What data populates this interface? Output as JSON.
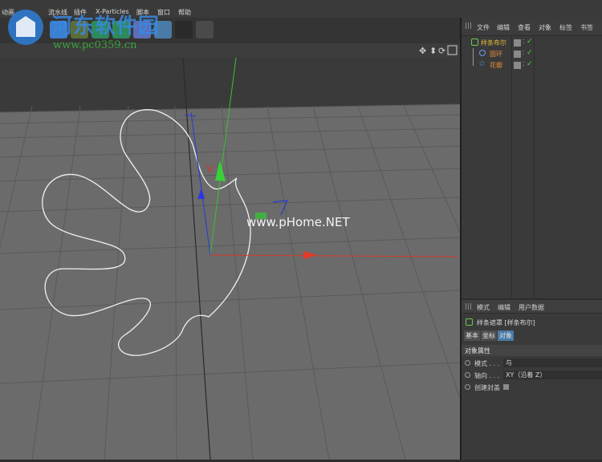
{
  "menubar": {
    "items": [
      "动画",
      "",
      "流水线",
      "插件",
      "X-Particles",
      "脚本",
      "窗口",
      "帮助"
    ]
  },
  "watermark": {
    "logo_text": "河东软件园",
    "url_text": "www.pc0359.cn",
    "center_text": "www.pHome.NET"
  },
  "object_manager": {
    "menu": [
      "文件",
      "编辑",
      "查看",
      "对象",
      "标签",
      "书签"
    ],
    "objects": [
      {
        "name": "样条布尔",
        "color": "#e8b93a"
      },
      {
        "name": "圆环",
        "color": "#e08a3a"
      },
      {
        "name": "花瓣",
        "color": "#e08a3a"
      }
    ]
  },
  "attributes": {
    "menu": [
      "模式",
      "编辑",
      "用户数据"
    ],
    "title": "样条遮罩 [样条布尔]",
    "tabs": [
      "基本",
      "坐标",
      "对象"
    ],
    "active_tab": "对象",
    "section": "对象属性",
    "props": [
      {
        "label": "模式 . . .",
        "value": "与"
      },
      {
        "label": "轴向 . . .",
        "value": "XY（沿着 Z）"
      },
      {
        "label": "创建封盖",
        "value": ""
      }
    ]
  },
  "colors": {
    "panel": "#3a3a3a",
    "viewport": "#3b3b3b",
    "accent": "#4a7ba6",
    "x_axis": "#d23a2a",
    "y_axis": "#3ac03a",
    "z_axis": "#2a3ad2",
    "spline": "#f0f0f0"
  }
}
